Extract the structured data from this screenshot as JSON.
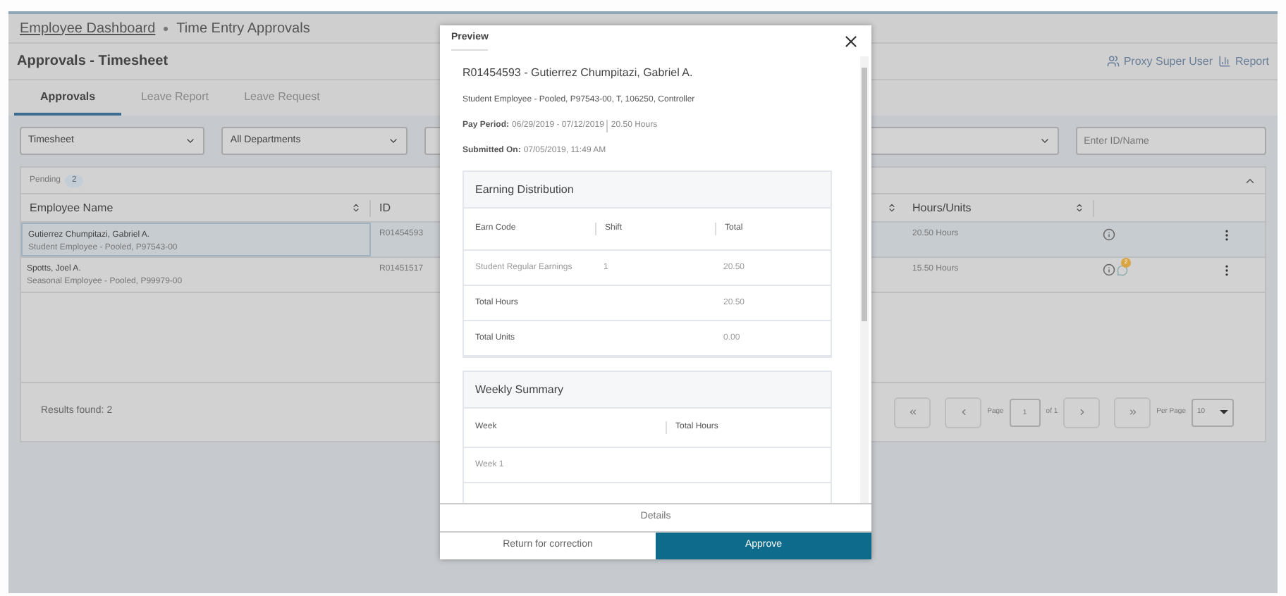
{
  "breadcrumb": [
    {
      "label": "Employee Dashboard",
      "kind": "link"
    },
    {
      "label": "Time Entry Approvals",
      "kind": "current"
    }
  ],
  "page_title": "Approvals - Timesheet",
  "header_links": [
    {
      "label": "Proxy Super User",
      "kind": "proxy"
    },
    {
      "label": "Report",
      "kind": "report"
    }
  ],
  "tabs": [
    {
      "label": "Approvals",
      "selected": true
    },
    {
      "label": "Leave Report",
      "selected": false
    },
    {
      "label": "Leave Request",
      "selected": false
    }
  ],
  "filters": {
    "dropdowns": [
      "Timesheet",
      "All Departments"
    ],
    "search": {
      "placeholder": "Enter ID/Name"
    }
  },
  "pending": {
    "label": "Pending",
    "count": "2"
  },
  "table": {
    "columns": [
      "Employee Name",
      "ID",
      "Hours/Units"
    ],
    "rows": [
      {
        "name": "Gutierrez Chumpitazi, Gabriel A.",
        "position": "Student Employee - Pooled, P97543-00",
        "id": "R01454593",
        "hours": "20.50 Hours",
        "selected": true,
        "comments": ""
      },
      {
        "name": "Spotts, Joel A.",
        "position": "Seasonal Employee - Pooled, P99979-00",
        "id": "R01451517",
        "hours": "15.50 Hours",
        "selected": false,
        "comments": "2"
      }
    ]
  },
  "results": "Results found: 2",
  "pagination": {
    "page_label": "Page",
    "page": "1",
    "of": "of 1",
    "per_page_label": "Per Page",
    "per_page": "10"
  },
  "modal": {
    "title": "Preview",
    "heading": "R01454593 - Gutierrez Chumpitazi, Gabriel A.",
    "subheading": "Student Employee - Pooled, P97543-00, T, 106250, Controller",
    "details": [
      {
        "label": "Pay Period:",
        "value": "06/29/2019 - 07/12/2019",
        "extra": "20.50 Hours"
      },
      {
        "label": "Submitted On:",
        "value": "07/05/2019, 11:49 AM"
      }
    ],
    "earning": {
      "title": "Earning Distribution",
      "columns": [
        "Earn Code",
        "Shift",
        "Total"
      ],
      "rows": [
        {
          "kind": "entry",
          "cells": [
            "Student Regular Earnings",
            "1",
            "20.50"
          ]
        },
        {
          "kind": "total",
          "cells": [
            "Total Hours",
            "",
            "20.50"
          ]
        },
        {
          "kind": "total",
          "cells": [
            "Total Units",
            "",
            "0.00"
          ]
        }
      ]
    },
    "weekly": {
      "title": "Weekly Summary",
      "columns": [
        "Week",
        "Total Hours"
      ],
      "rows": [
        "Week 1"
      ]
    },
    "details_button": "Details",
    "return_button": "Return for correction",
    "approve_button": "Approve"
  }
}
